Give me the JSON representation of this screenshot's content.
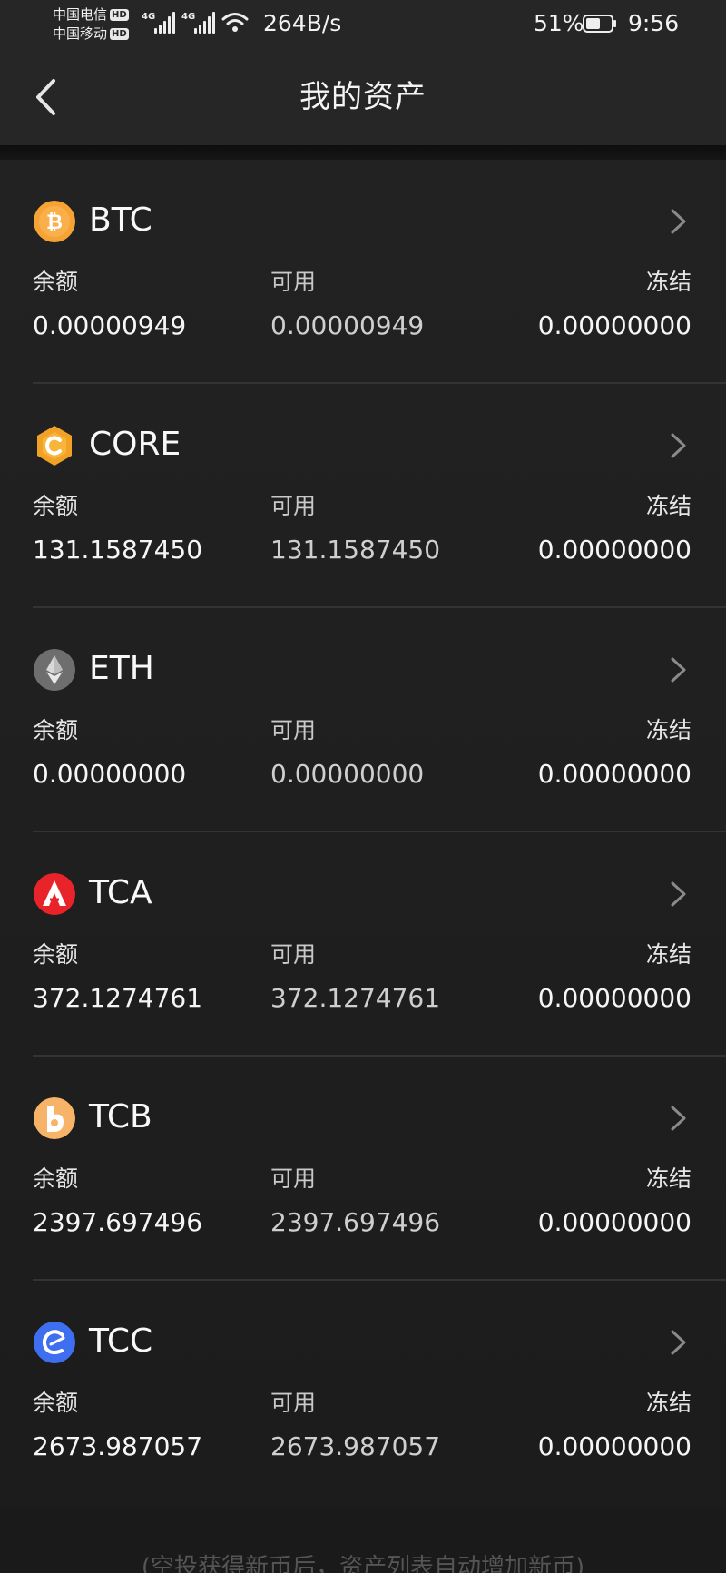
{
  "status_bar": {
    "carrier_1": "中国电信",
    "carrier_2": "中国移动",
    "hd_badge": "HD",
    "net_type": "4G",
    "speed": "264B/s",
    "battery": "51%",
    "time": "9:56"
  },
  "header": {
    "title": "我的资产",
    "back_icon": "chevron-left-icon"
  },
  "columns": {
    "balance": "余额",
    "available": "可用",
    "frozen": "冻结"
  },
  "assets": [
    {
      "name": "BTC",
      "icon": "btc-coin-icon",
      "color": "#f7a334",
      "balance": "0.00000949",
      "available": "0.00000949",
      "frozen": "0.00000000"
    },
    {
      "name": "CORE",
      "icon": "core-coin-icon",
      "color": "#f2a127",
      "balance": "131.1587450",
      "available": "131.1587450",
      "frozen": "0.00000000"
    },
    {
      "name": "ETH",
      "icon": "eth-coin-icon",
      "color": "#6e6e6e",
      "balance": "0.00000000",
      "available": "0.00000000",
      "frozen": "0.00000000"
    },
    {
      "name": "TCA",
      "icon": "tca-coin-icon",
      "color": "#e8232a",
      "balance": "372.1274761",
      "available": "372.1274761",
      "frozen": "0.00000000"
    },
    {
      "name": "TCB",
      "icon": "tcb-coin-icon",
      "color": "#f7b468",
      "balance": "2397.697496",
      "available": "2397.697496",
      "frozen": "0.00000000"
    },
    {
      "name": "TCC",
      "icon": "tcc-coin-icon",
      "color": "#3d6ff0",
      "balance": "2673.987057",
      "available": "2673.987057",
      "frozen": "0.00000000"
    }
  ],
  "footer": {
    "note": "(空投获得新币后，资产列表自动增加新币)"
  }
}
